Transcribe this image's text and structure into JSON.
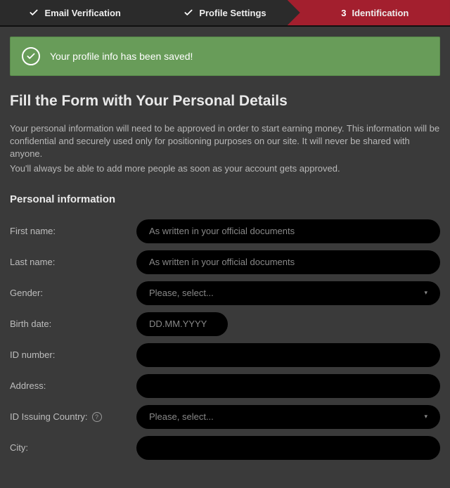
{
  "steps": {
    "s1": "Email Verification",
    "s2": "Profile Settings",
    "s3_num": "3",
    "s3": "Identification"
  },
  "banner": {
    "message": "Your profile info has been saved!"
  },
  "title": "Fill the Form with Your Personal Details",
  "desc1": "Your personal information will need to be approved in order to start earning money. This information will be confidential and securely used only for positioning purposes on our site. It will never be shared with anyone.",
  "desc2": "You'll always be able to add more people as soon as your account gets approved.",
  "section_personal": "Personal information",
  "labels": {
    "first_name": "First name:",
    "last_name": "Last name:",
    "gender": "Gender:",
    "birth_date": "Birth date:",
    "id_number": "ID number:",
    "address": "Address:",
    "id_country": "ID Issuing Country:",
    "city": "City:"
  },
  "placeholders": {
    "first_name": "As written in your official documents",
    "last_name": "As written in your official documents",
    "gender": "Please, select...",
    "birth_date": "DD.MM.YYYY",
    "id_country": "Please, select..."
  },
  "help_q": "?"
}
